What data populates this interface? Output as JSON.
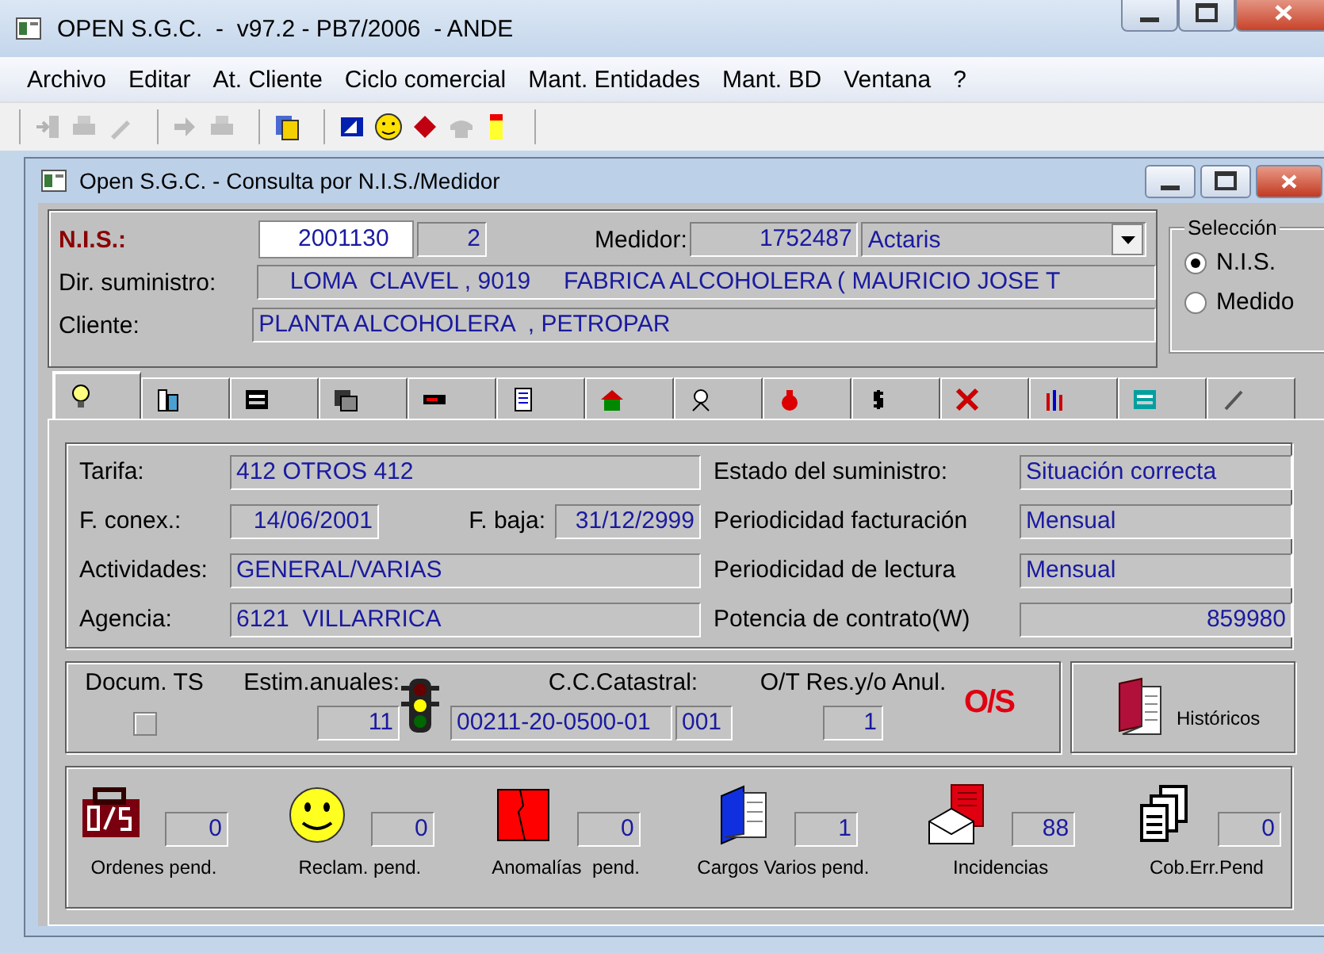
{
  "window": {
    "title": "OPEN S.G.C.  -  v97.2 - PB7/2006  - ANDE"
  },
  "menu": [
    "Archivo",
    "Editar",
    "At. Cliente",
    "Ciclo comercial",
    "Mant. Entidades",
    "Mant. BD",
    "Ventana",
    "?"
  ],
  "toolbar": [
    [
      {
        "disabled": true
      },
      {
        "disabled": true
      },
      {
        "disabled": true
      }
    ],
    [
      {
        "disabled": true
      },
      {
        "disabled": true
      }
    ],
    [
      {
        "disabled": false
      }
    ],
    [
      {
        "disabled": false
      },
      {
        "disabled": false
      },
      {
        "disabled": false
      },
      {
        "disabled": true
      },
      {
        "disabled": false
      }
    ]
  ],
  "child_window": {
    "title": "Open S.G.C. - Consulta por N.I.S./Medidor"
  },
  "header": {
    "nis_label": "N.I.S.:",
    "nis": "2001130",
    "nis_suffix": "2",
    "medidor_label": "Medidor:",
    "medidor": "1752487",
    "marca": "Actaris",
    "dir_label": "Dir. suministro:",
    "dir": "LOMA  CLAVEL , 9019     FABRICA ALCOHOLERA ( MAURICIO JOSE T",
    "cliente_label": "Cliente:",
    "cliente": "PLANTA ALCOHOLERA  , PETROPAR"
  },
  "seleccion": {
    "title": "Selección",
    "options": [
      {
        "label": "N.I.S.",
        "selected": true
      },
      {
        "label": "Medido",
        "selected": false
      }
    ]
  },
  "tabs": [
    {
      "selected": true
    },
    {
      "selected": false
    },
    {
      "selected": false
    },
    {
      "selected": false
    },
    {
      "selected": false
    },
    {
      "selected": false
    },
    {
      "selected": false
    },
    {
      "selected": false
    },
    {
      "selected": false
    },
    {
      "selected": false
    },
    {
      "selected": false
    },
    {
      "selected": false
    },
    {
      "selected": false
    },
    {
      "selected": false
    }
  ],
  "suministro": {
    "tarifa_label": "Tarifa:",
    "tarifa": "412 OTROS 412",
    "conex_label": "F. conex.:",
    "conex": "14/06/2001",
    "baja_label": "F. baja:",
    "baja": "31/12/2999",
    "act_label": "Actividades:",
    "actividades": "GENERAL/VARIAS",
    "agencia_label": "Agencia:",
    "agencia": "6121  VILLARRICA",
    "estado_label": "Estado del suministro:",
    "estado": "Situación correcta",
    "pfact_label": "Periodicidad facturación",
    "pfact": "Mensual",
    "plect_label": "Periodicidad de lectura",
    "plect": "Mensual",
    "potencia_label": "Potencia de contrato(W)",
    "potencia": "859980"
  },
  "extra": {
    "docum_label": "Docum. TS",
    "docum_checked": false,
    "estim_label": "Estim.anuales:",
    "estim": "11",
    "catastral_label": "C.C.Catastral:",
    "catastral": "00211-20-0500-01",
    "catastral_suffix": "001",
    "ot_label": "O/T Res.y/o Anul.",
    "ot": "1",
    "ot_badge": "O/S",
    "historicos": "Históricos"
  },
  "pending": [
    {
      "label": "Ordenes pend.",
      "count": "0"
    },
    {
      "label": "Reclam. pend.",
      "count": "0"
    },
    {
      "label": "Anomalías  pend.",
      "count": "0"
    },
    {
      "label": "Cargos Varios pend.",
      "count": "1"
    },
    {
      "label": "Incidencias",
      "count": "88"
    },
    {
      "label": "Cob.Err.Pend",
      "count": "0"
    }
  ]
}
